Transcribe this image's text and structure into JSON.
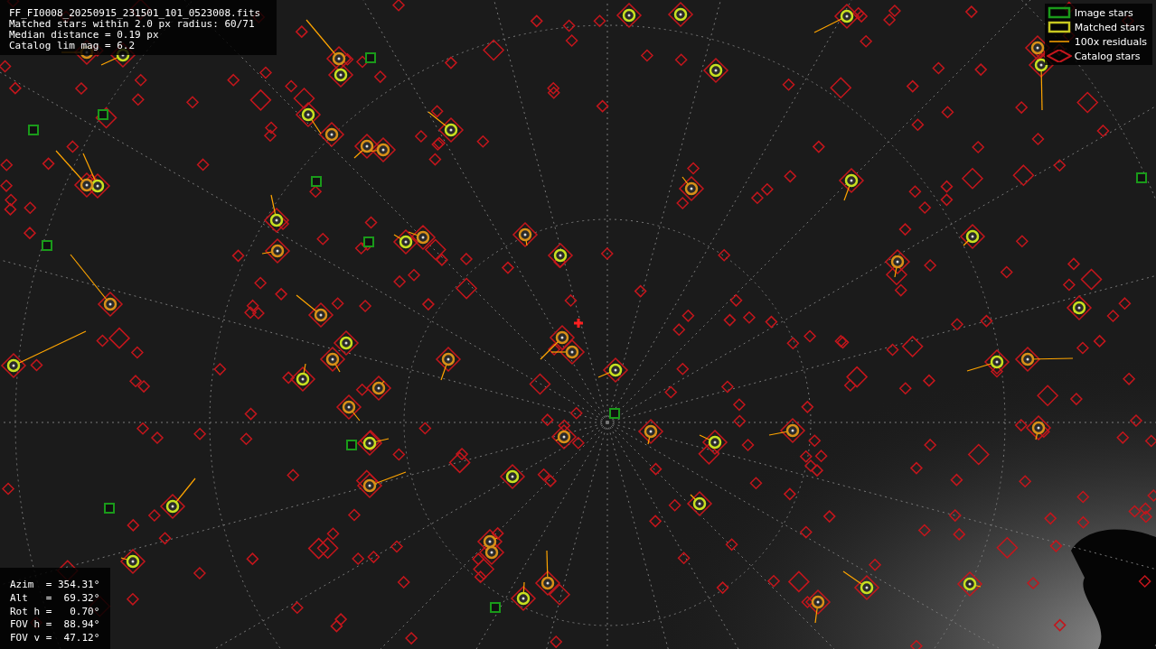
{
  "info_panel": {
    "lines": [
      "FF_FI0008_20250915_231501_101_0523008.fits",
      "Matched stars within 2.0 px radius: 60/71",
      "Median distance = 0.19 px",
      "Catalog lim mag = 6.2"
    ]
  },
  "legend": {
    "items": [
      {
        "kind": "image",
        "label": "Image stars"
      },
      {
        "kind": "matched",
        "label": "Matched stars"
      },
      {
        "kind": "residual",
        "label": "100x residuals"
      },
      {
        "kind": "catalog",
        "label": "Catalog stars"
      }
    ]
  },
  "pointing_panel": {
    "lines": [
      "Azim  = 354.31°",
      "Alt   =  69.32°",
      "Rot h =   0.70°",
      "FOV h =  88.94°",
      "FOV v =  47.12°"
    ]
  }
}
